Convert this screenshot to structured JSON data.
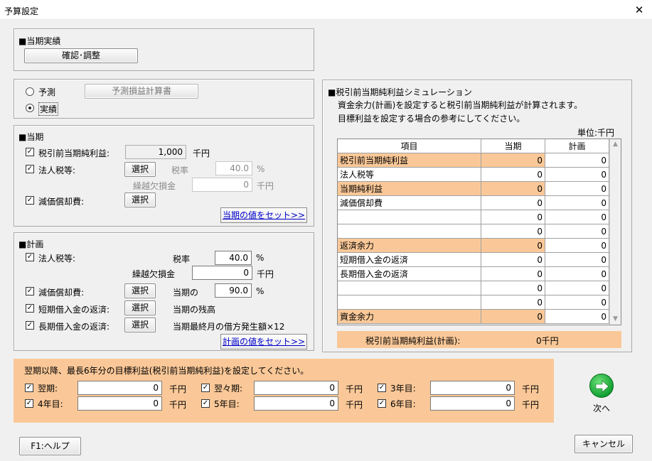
{
  "window": {
    "title": "予算設定",
    "close": "✕"
  },
  "actual": {
    "heading": "■当期実績",
    "confirm_button": "確認･調整"
  },
  "mode": {
    "forecast_label": "予測",
    "forecast_button": "予測損益計算書",
    "actual_label": "実績",
    "selected": "実績"
  },
  "current": {
    "heading": "■当期",
    "pretax_label": "税引前当期純利益:",
    "pretax_value": "1,000",
    "pretax_unit": "千円",
    "tax_label": "法人税等:",
    "tax_select": "選択",
    "tax_rate_label": "税率",
    "tax_rate_value": "40.0",
    "tax_rate_unit": "%",
    "loss_label": "繰越欠損金",
    "loss_value": "0",
    "loss_unit": "千円",
    "dep_label": "減価償却費:",
    "dep_select": "選択",
    "set_button": "当期の値をセット>>"
  },
  "plan": {
    "heading": "■計画",
    "tax_label": "法人税等:",
    "tax_rate_label": "税率",
    "tax_rate_value": "40.0",
    "tax_rate_unit": "%",
    "loss_label": "繰越欠損金",
    "loss_value": "0",
    "loss_unit": "千円",
    "dep_label": "減価償却費:",
    "dep_select": "選択",
    "dep_of_label": "当期の",
    "dep_pct_value": "90.0",
    "dep_pct_unit": "%",
    "short_label": "短期借入金の返済:",
    "short_select": "選択",
    "short_note": "当期の残高",
    "long_label": "長期借入金の返済:",
    "long_select": "選択",
    "long_note": "当期最終月の借方発生額×12",
    "set_button": "計画の値をセット>>"
  },
  "simulation": {
    "heading": "■税引前当期純利益シミュレーション",
    "desc1": "資金余力(計画)を設定すると税引前当期純利益が計算されます。",
    "desc2": "目標利益を設定する場合の参考にしてください。",
    "unit": "単位:千円",
    "headers": [
      "項目",
      "当期",
      "計画"
    ],
    "rows": [
      {
        "item": "税引前当期純利益",
        "current": "0",
        "plan": "0",
        "hl": true
      },
      {
        "item": "法人税等",
        "current": "0",
        "plan": "0",
        "hl": false
      },
      {
        "item": "当期純利益",
        "current": "0",
        "plan": "0",
        "hl": true
      },
      {
        "item": "減価償却費",
        "current": "0",
        "plan": "0",
        "hl": false
      },
      {
        "item": "",
        "current": "0",
        "plan": "0",
        "hl": false
      },
      {
        "item": "",
        "current": "0",
        "plan": "0",
        "hl": false
      },
      {
        "item": "返済余力",
        "current": "0",
        "plan": "0",
        "hl": true
      },
      {
        "item": "短期借入金の返済",
        "current": "0",
        "plan": "0",
        "hl": false
      },
      {
        "item": "長期借入金の返済",
        "current": "0",
        "plan": "0",
        "hl": false
      },
      {
        "item": "",
        "current": "0",
        "plan": "0",
        "hl": false
      },
      {
        "item": "",
        "current": "0",
        "plan": "0",
        "hl": false
      },
      {
        "item": "資金余力",
        "current": "0",
        "plan": "0",
        "hl": true
      }
    ],
    "result_label": "税引前当期純利益(計画):",
    "result_value": "0千円"
  },
  "targets": {
    "heading": "翌期以降、最長6年分の目標利益(税引前当期純利益)を設定してください。",
    "unit": "千円",
    "items": [
      {
        "label": "翌期:",
        "value": "0"
      },
      {
        "label": "翌々期:",
        "value": "0"
      },
      {
        "label": "3年目:",
        "value": "0"
      },
      {
        "label": "4年目:",
        "value": "0"
      },
      {
        "label": "5年目:",
        "value": "0"
      },
      {
        "label": "6年目:",
        "value": "0"
      }
    ]
  },
  "footer": {
    "next_label": "次へ",
    "help_button": "F1:ヘルプ",
    "cancel_button": "キャンセル"
  },
  "colors": {
    "highlight": "#fac898",
    "accent_green": "#12a032",
    "link_blue": "#0000cc"
  },
  "icons": {
    "next": "arrow-right-circle-icon",
    "check": "check-icon",
    "close": "close-icon"
  }
}
